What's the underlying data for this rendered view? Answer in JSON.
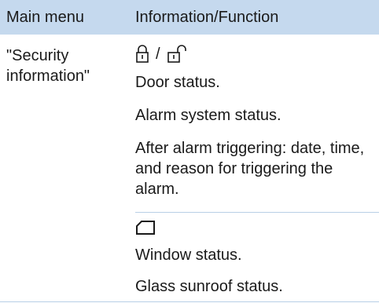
{
  "header": {
    "col1": "Main menu",
    "col2": "Information/Function"
  },
  "row": {
    "main_menu": "\"Security information\"",
    "lock_separator": "/",
    "lines1": [
      "Door status.",
      "Alarm system status.",
      "After alarm triggering: date, time, and reason for trigger­ing the alarm."
    ],
    "lines2": [
      "Window status.",
      "Glass sunroof status."
    ]
  },
  "icons": [
    "lock-closed-icon",
    "lock-open-icon",
    "window-icon"
  ],
  "colors": {
    "header_bg": "#c5d9ee",
    "divider": "#b8cfe6"
  }
}
